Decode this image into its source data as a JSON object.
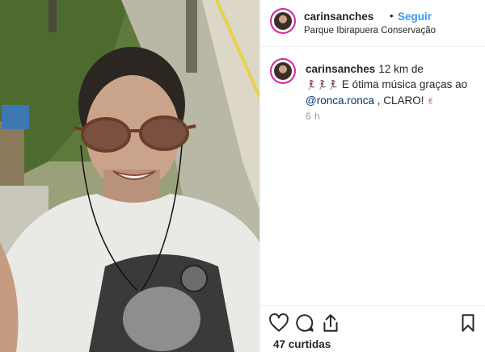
{
  "header": {
    "username": "carinsanches",
    "separator": "•",
    "follow_label": "Seguir",
    "location": "Parque Ibirapuera Conservação"
  },
  "caption": {
    "username": "carinsanches",
    "text_start": "12 km de",
    "emojis": "🏃‍♀️🏃‍♀️🏃‍♀️",
    "text_middle": "E ótima música graças ao",
    "mention": "@ronca.ronca",
    "text_end": ", CLARO!",
    "end_emoji": "✌"
  },
  "timestamp": "6 h",
  "likes": "47 curtidas",
  "icons": {
    "like": "heart-icon",
    "comment": "comment-icon",
    "share": "share-icon",
    "save": "bookmark-icon"
  },
  "colors": {
    "follow": "#3897f0",
    "mention": "#003569",
    "muted": "#999999",
    "text": "#262626"
  }
}
